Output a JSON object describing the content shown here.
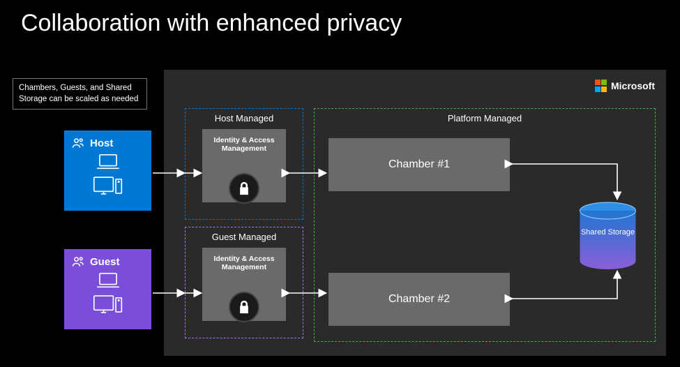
{
  "title": "Collaboration with enhanced privacy",
  "note": "Chambers, Guests, and Shared Storage can be scaled as needed",
  "brand": "Microsoft",
  "actors": {
    "host": "Host",
    "guest": "Guest"
  },
  "managed": {
    "host_label": "Host Managed",
    "guest_label": "Guest Managed",
    "iam": "Identity & Access Management"
  },
  "platform": {
    "label": "Platform Managed",
    "chamber1": "Chamber #1",
    "chamber2": "Chamber #2",
    "storage": "Shared Storage"
  }
}
